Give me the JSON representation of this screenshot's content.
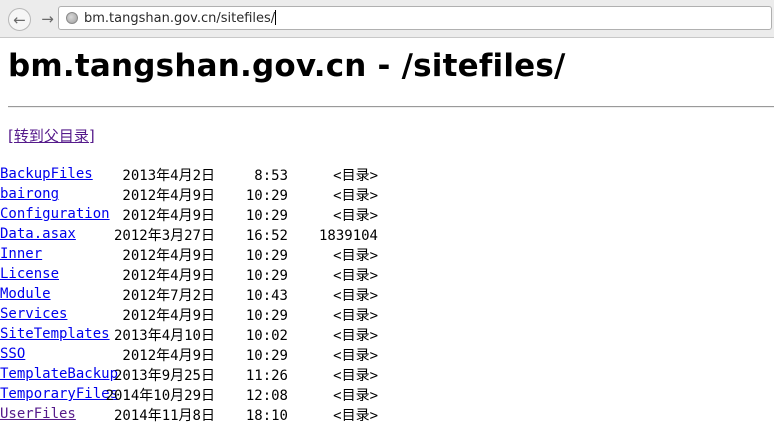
{
  "browser": {
    "url": "bm.tangshan.gov.cn/sitefiles/",
    "back_icon": "back-arrow-icon",
    "forward_icon": "forward-arrow-icon",
    "site_icon": "globe-icon"
  },
  "page": {
    "title": "bm.tangshan.gov.cn - /sitefiles/",
    "parent_link": "[转到父目录]",
    "colors": {
      "link": "#0000ee",
      "visited": "#551a8b"
    }
  },
  "entries": [
    {
      "date": "2013年4月2日",
      "time": "8:53",
      "size": "<目录>",
      "name": "BackupFiles",
      "visited": false
    },
    {
      "date": "2012年4月9日",
      "time": "10:29",
      "size": "<目录>",
      "name": "bairong",
      "visited": false
    },
    {
      "date": "2012年4月9日",
      "time": "10:29",
      "size": "<目录>",
      "name": "Configuration",
      "visited": false
    },
    {
      "date": "2012年3月27日",
      "time": "16:52",
      "size": "1839104",
      "name": "Data.asax",
      "visited": false
    },
    {
      "date": "2012年4月9日",
      "time": "10:29",
      "size": "<目录>",
      "name": "Inner",
      "visited": false
    },
    {
      "date": "2012年4月9日",
      "time": "10:29",
      "size": "<目录>",
      "name": "License",
      "visited": false
    },
    {
      "date": "2012年7月2日",
      "time": "10:43",
      "size": "<目录>",
      "name": "Module",
      "visited": false
    },
    {
      "date": "2012年4月9日",
      "time": "10:29",
      "size": "<目录>",
      "name": "Services",
      "visited": false
    },
    {
      "date": "2013年4月10日",
      "time": "10:02",
      "size": "<目录>",
      "name": "SiteTemplates",
      "visited": false
    },
    {
      "date": "2012年4月9日",
      "time": "10:29",
      "size": "<目录>",
      "name": "SSO",
      "visited": false
    },
    {
      "date": "2013年9月25日",
      "time": "11:26",
      "size": "<目录>",
      "name": "TemplateBackup",
      "visited": false
    },
    {
      "date": "2014年10月29日",
      "time": "12:08",
      "size": "<目录>",
      "name": "TemporaryFiles",
      "visited": false
    },
    {
      "date": "2014年11月8日",
      "time": "18:10",
      "size": "<目录>",
      "name": "UserFiles",
      "visited": true
    }
  ]
}
